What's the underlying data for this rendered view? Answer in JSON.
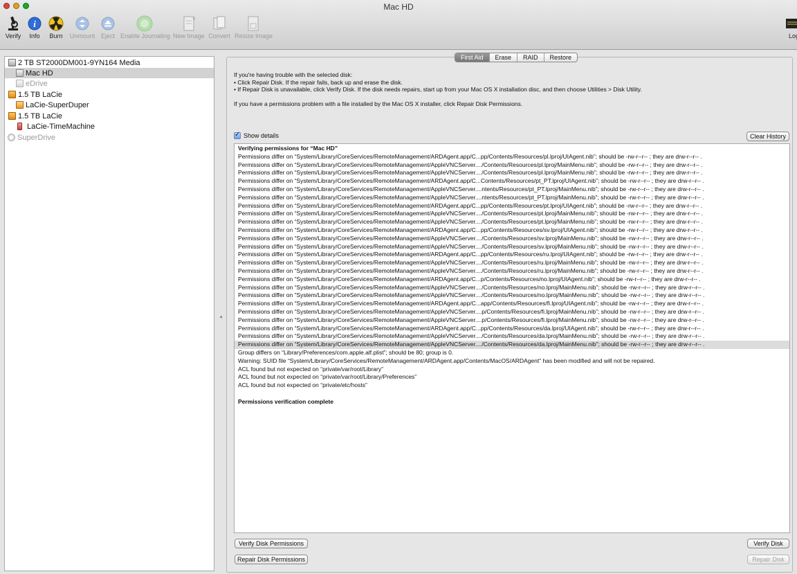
{
  "window": {
    "title": "Mac HD"
  },
  "toolbar": {
    "verify": "Verify",
    "info": "Info",
    "burn": "Burn",
    "unmount": "Unmount",
    "eject": "Eject",
    "enable_journaling": "Enable Journaling",
    "new_image": "New Image",
    "convert": "Convert",
    "resize_image": "Resize Image",
    "log": "Log"
  },
  "sidebar": {
    "items": [
      {
        "label": "2 TB ST2000DM001-9YN164 Media",
        "icon": "hard-disk-icon"
      },
      {
        "label": "Mac HD",
        "icon": "volume-icon",
        "selected": true
      },
      {
        "label": "eDrive",
        "icon": "volume-icon",
        "dim": true
      },
      {
        "label": "1.5 TB LaCie",
        "icon": "external-disk-icon"
      },
      {
        "label": "LaCie-SuperDuper",
        "icon": "external-volume-icon"
      },
      {
        "label": "1.5 TB LaCie",
        "icon": "external-disk-icon"
      },
      {
        "label": "LaCie-TimeMachine",
        "icon": "time-machine-volume-icon"
      },
      {
        "label": "SuperDrive",
        "icon": "optical-drive-icon",
        "dim": true
      }
    ]
  },
  "tabs": [
    {
      "label": "First Aid",
      "active": true
    },
    {
      "label": "Erase"
    },
    {
      "label": "RAID"
    },
    {
      "label": "Restore"
    }
  ],
  "help": {
    "line1": "If you're having trouble with the selected disk:",
    "line2": "• Click Repair Disk. If the repair fails, back up and erase the disk.",
    "line3": "• If Repair Disk is unavailable, click Verify Disk. If the disk needs repairs, start up from your Mac OS X installation disc, and then choose Utilities > Disk Utility.",
    "line4": "If you have a permissions problem with a file installed by the Mac OS X installer, click Repair Disk Permissions."
  },
  "show_details": {
    "label": "Show details",
    "checked": true
  },
  "buttons": {
    "clear_history": "Clear History",
    "verify_permissions": "Verify Disk Permissions",
    "repair_permissions": "Repair Disk Permissions",
    "verify_disk": "Verify Disk",
    "repair_disk": "Repair Disk"
  },
  "log": [
    "Verifying permissions for “Mac HD”",
    "Permissions differ on “System/Library/CoreServices/RemoteManagement/ARDAgent.app/C...pp/Contents/Resources/pl.lproj/UIAgent.nib”; should be -rw-r--r-- ; they are drw-r--r-- .",
    "Permissions differ on “System/Library/CoreServices/RemoteManagement/AppleVNCServer..../Contents/Resources/pl.lproj/MainMenu.nib”; should be -rw-r--r-- ; they are drw-r--r-- .",
    "Permissions differ on “System/Library/CoreServices/RemoteManagement/AppleVNCServer..../Contents/Resources/pl.lproj/MainMenu.nib”; should be -rw-r--r-- ; they are drw-r--r-- .",
    "Permissions differ on “System/Library/CoreServices/RemoteManagement/ARDAgent.app/C...Contents/Resources/pt_PT.lproj/UIAgent.nib”; should be -rw-r--r-- ; they are drw-r--r-- .",
    "Permissions differ on “System/Library/CoreServices/RemoteManagement/AppleVNCServer....ntents/Resources/pt_PT.lproj/MainMenu.nib”; should be -rw-r--r-- ; they are drw-r--r-- .",
    "Permissions differ on “System/Library/CoreServices/RemoteManagement/AppleVNCServer....ntents/Resources/pt_PT.lproj/MainMenu.nib”; should be -rw-r--r-- ; they are drw-r--r-- .",
    "Permissions differ on “System/Library/CoreServices/RemoteManagement/ARDAgent.app/C...pp/Contents/Resources/pt.lproj/UIAgent.nib”; should be -rw-r--r-- ; they are drw-r--r-- .",
    "Permissions differ on “System/Library/CoreServices/RemoteManagement/AppleVNCServer..../Contents/Resources/pt.lproj/MainMenu.nib”; should be -rw-r--r-- ; they are drw-r--r-- .",
    "Permissions differ on “System/Library/CoreServices/RemoteManagement/AppleVNCServer..../Contents/Resources/pt.lproj/MainMenu.nib”; should be -rw-r--r-- ; they are drw-r--r-- .",
    "Permissions differ on “System/Library/CoreServices/RemoteManagement/ARDAgent.app/C...pp/Contents/Resources/sv.lproj/UIAgent.nib”; should be -rw-r--r-- ; they are drw-r--r-- .",
    "Permissions differ on “System/Library/CoreServices/RemoteManagement/AppleVNCServer..../Contents/Resources/sv.lproj/MainMenu.nib”; should be -rw-r--r-- ; they are drw-r--r-- .",
    "Permissions differ on “System/Library/CoreServices/RemoteManagement/AppleVNCServer..../Contents/Resources/sv.lproj/MainMenu.nib”; should be -rw-r--r-- ; they are drw-r--r-- .",
    "Permissions differ on “System/Library/CoreServices/RemoteManagement/ARDAgent.app/C...pp/Contents/Resources/ru.lproj/UIAgent.nib”; should be -rw-r--r-- ; they are drw-r--r-- .",
    "Permissions differ on “System/Library/CoreServices/RemoteManagement/AppleVNCServer..../Contents/Resources/ru.lproj/MainMenu.nib”; should be -rw-r--r-- ; they are drw-r--r-- .",
    "Permissions differ on “System/Library/CoreServices/RemoteManagement/AppleVNCServer..../Contents/Resources/ru.lproj/MainMenu.nib”; should be -rw-r--r-- ; they are drw-r--r-- .",
    "Permissions differ on “System/Library/CoreServices/RemoteManagement/ARDAgent.app/C...p/Contents/Resources/no.lproj/UIAgent.nib”; should be -rw-r--r-- ; they are drw-r--r-- .",
    "Permissions differ on “System/Library/CoreServices/RemoteManagement/AppleVNCServer..../Contents/Resources/no.lproj/MainMenu.nib”; should be -rw-r--r-- ; they are drw-r--r-- .",
    "Permissions differ on “System/Library/CoreServices/RemoteManagement/AppleVNCServer..../Contents/Resources/no.lproj/MainMenu.nib”; should be -rw-r--r-- ; they are drw-r--r-- .",
    "Permissions differ on “System/Library/CoreServices/RemoteManagement/ARDAgent.app/C...app/Contents/Resources/fi.lproj/UIAgent.nib”; should be -rw-r--r-- ; they are drw-r--r-- .",
    "Permissions differ on “System/Library/CoreServices/RemoteManagement/AppleVNCServer....p/Contents/Resources/fi.lproj/MainMenu.nib”; should be -rw-r--r-- ; they are drw-r--r-- .",
    "Permissions differ on “System/Library/CoreServices/RemoteManagement/AppleVNCServer....p/Contents/Resources/fi.lproj/MainMenu.nib”; should be -rw-r--r-- ; they are drw-r--r-- .",
    "Permissions differ on “System/Library/CoreServices/RemoteManagement/ARDAgent.app/C...pp/Contents/Resources/da.lproj/UIAgent.nib”; should be -rw-r--r-- ; they are drw-r--r-- .",
    "Permissions differ on “System/Library/CoreServices/RemoteManagement/AppleVNCServer..../Contents/Resources/da.lproj/MainMenu.nib”; should be -rw-r--r-- ; they are drw-r--r-- .",
    "Permissions differ on “System/Library/CoreServices/RemoteManagement/AppleVNCServer..../Contents/Resources/da.lproj/MainMenu.nib”; should be -rw-r--r-- ; they are drw-r--r-- .",
    "Group differs on “Library/Preferences/com.apple.alf.plist”; should be 80; group is 0.",
    "Warning: SUID file “System/Library/CoreServices/RemoteManagement/ARDAgent.app/Contents/MacOS/ARDAgent” has been modified and will not be repaired.",
    "ACL found but not expected on “private/var/root/Library”",
    "ACL found but not expected on “private/var/root/Library/Preferences”",
    "ACL found but not expected on “private/etc/hosts”",
    "",
    "Permissions verification complete"
  ]
}
